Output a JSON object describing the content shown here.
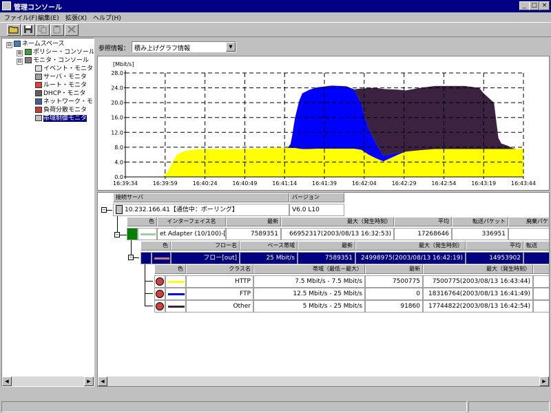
{
  "window": {
    "title": "管理コンソール",
    "min": "_",
    "max": "□",
    "close": "×"
  },
  "menu": [
    "ファイル(F)",
    "編集(E)",
    "拡張(X)",
    "ヘルプ(H)"
  ],
  "tree": {
    "items": [
      {
        "label": "ネームスペース",
        "expander": "⊟",
        "icon": "namespace-icon"
      },
      {
        "label": "ポリシー・コンソール",
        "expander": "⊞",
        "icon": "policy-console-icon"
      },
      {
        "label": "モニタ・コンソール",
        "expander": "⊟",
        "icon": "monitor-console-icon"
      },
      {
        "label": "イベント・モニタ",
        "icon": "event-monitor-icon"
      },
      {
        "label": "サーバ・モニタ",
        "icon": "server-monitor-icon"
      },
      {
        "label": "ルート・モニタ",
        "icon": "route-monitor-icon"
      },
      {
        "label": "DHCP・モニタ",
        "icon": "dhcp-monitor-icon"
      },
      {
        "label": "ネットワーク・モ",
        "icon": "network-monitor-icon"
      },
      {
        "label": "負荷分散モニタ",
        "icon": "load-balance-monitor-icon"
      },
      {
        "label": "帯域制御モニタ",
        "icon": "bandwidth-monitor-icon",
        "selected": true
      }
    ]
  },
  "ref": {
    "label": "参照情報：",
    "selected": "積み上げグラフ情報"
  },
  "chart_data": {
    "type": "area",
    "stacked": true,
    "ylabel": "[Mbit/s]",
    "ylim": [
      0,
      28
    ],
    "yticks": [
      "0.0",
      "4.0",
      "8.0",
      "12.0",
      "16.0",
      "20.0",
      "24.0",
      "28.0"
    ],
    "xticks": [
      "16:39:34",
      "16:39:59",
      "16:40:24",
      "16:40:49",
      "16:41:14",
      "16:41:39",
      "16:42:04",
      "16:42:29",
      "16:42:54",
      "16:43:19",
      "16:43:44"
    ],
    "x": [
      0,
      12,
      25,
      28,
      32,
      35,
      40,
      45,
      50,
      60,
      75,
      90,
      100,
      110,
      112,
      113,
      115,
      118,
      120,
      125,
      130,
      140,
      150,
      155,
      160,
      162,
      165,
      170,
      175,
      185,
      190,
      200,
      210,
      230,
      240,
      243,
      250,
      253,
      255,
      260,
      262,
      265,
      270
    ],
    "grid": true,
    "series": [
      {
        "name": "HTTP",
        "color": "#ffff00",
        "values": [
          0,
          0,
          0,
          1,
          4,
          6,
          7,
          7.2,
          7.5,
          7.5,
          7.5,
          7.6,
          7.8,
          7.8,
          7.8,
          7.8,
          7.8,
          7.6,
          7.5,
          7.5,
          7.6,
          7.6,
          7.6,
          7.6,
          7.3,
          6.8,
          6.0,
          5.0,
          4.2,
          6.0,
          6.8,
          7.2,
          7.5,
          7.5,
          7.5,
          7.5,
          7.5,
          7.5,
          7.5,
          7.5,
          7.5,
          7.5,
          7.5
        ]
      },
      {
        "name": "FTP",
        "color": "#0000ff",
        "values": [
          0,
          0,
          0,
          0,
          0,
          0,
          0,
          0,
          0,
          0,
          0,
          0,
          0,
          0,
          1,
          3,
          8,
          13,
          15,
          16,
          16.5,
          17,
          16.8,
          16,
          12.5,
          10,
          7,
          4,
          1.5,
          0.5,
          0,
          0,
          0,
          0,
          0,
          0,
          0,
          0,
          0,
          0,
          0,
          0,
          0
        ]
      },
      {
        "name": "Other",
        "color": "#3b2240",
        "values": [
          0,
          0,
          0,
          0,
          0,
          0,
          0,
          0,
          0,
          0,
          0,
          0,
          0,
          0,
          0,
          0,
          0,
          0,
          0,
          0,
          0,
          0,
          0,
          0,
          4,
          7,
          11,
          15,
          18,
          17,
          16.5,
          16.8,
          17,
          17,
          16.5,
          15,
          12.5,
          3,
          1.5,
          0.8,
          0.3,
          0,
          0
        ]
      }
    ]
  },
  "server_table": {
    "headers": [
      "接続サーバ",
      "バージョン"
    ],
    "server": "10.232.166.41【通信中：ポーリング】",
    "version": "V6.0 L10"
  },
  "if_table": {
    "headers": [
      "色",
      "インターフェイス名",
      "最新",
      "最大（発生時刻）",
      "平均",
      "転送パケット",
      "廃棄パケ"
    ],
    "row": {
      "name": "et Adapter (10/100)-[0]",
      "latest": "7589351",
      "max": "66952317(2003/08/13 16:32:53)",
      "avg": "17268646",
      "packets": "336951",
      "drops": ""
    }
  },
  "flow_table": {
    "headers": [
      "色",
      "フロー名",
      "ベース帯域",
      "最新",
      "最大（発生時刻）",
      "平均",
      "転送"
    ],
    "row": {
      "name": "フロー[out]",
      "base": "25 Mbit/s",
      "latest": "7589351",
      "max": "24998975(2003/08/13 16:42:19)",
      "avg": "14953902"
    }
  },
  "class_table": {
    "headers": [
      "色",
      "クラス名",
      "帯域（最低－最大）",
      "最新",
      "最大（発生時刻）"
    ],
    "rows": [
      {
        "color": "#ffff00",
        "name": "HTTP",
        "band": "7.5 Mbit/s - 7.5 Mbit/s",
        "latest": "7500775",
        "max": "7500775(2003/08/13 16:43:44)"
      },
      {
        "color": "#0000ff",
        "name": "FTP",
        "band": "12.5 Mbit/s - 25 Mbit/s",
        "latest": "0",
        "max": "18316764(2003/08/13 16:41:49)"
      },
      {
        "color": "#3b2240",
        "name": "Other",
        "band": "5 Mbit/s - 25 Mbit/s",
        "latest": "91860",
        "max": "17744822(2003/08/13 16:42:54)"
      }
    ]
  }
}
